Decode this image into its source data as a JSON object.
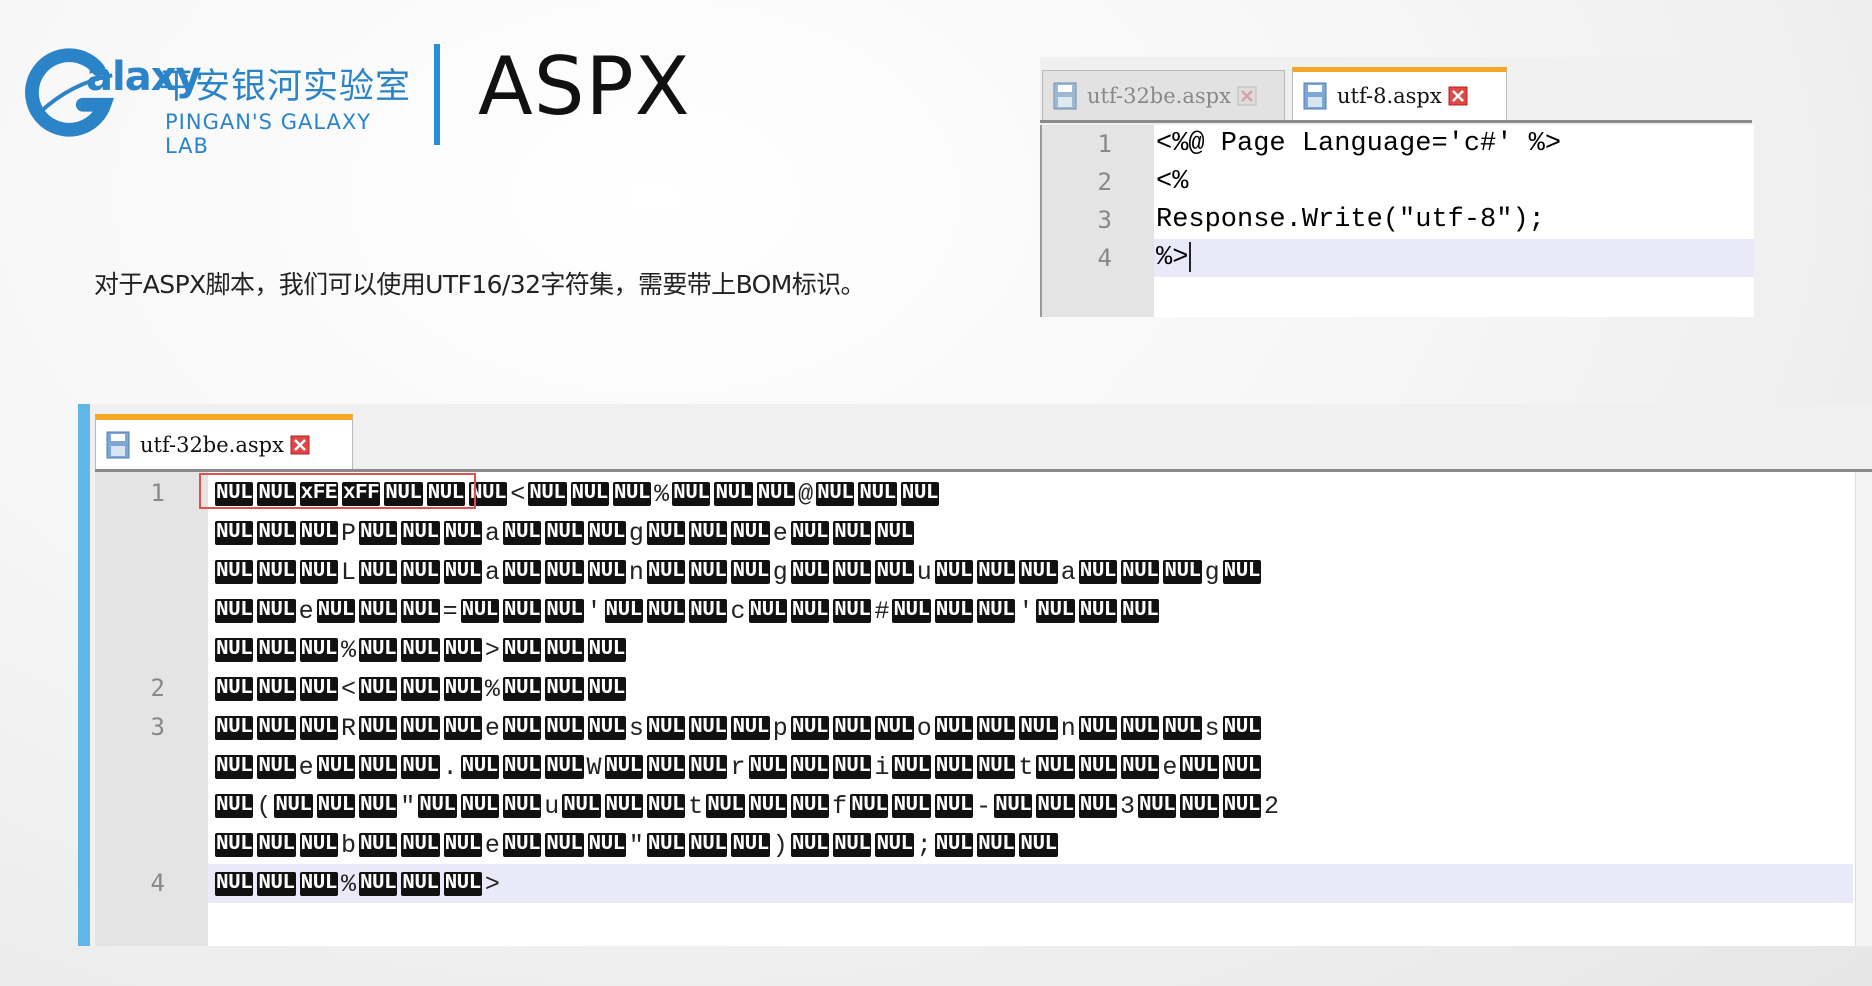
{
  "logo": {
    "icon": "galaxy-g-logo",
    "word": "alaxy",
    "chinese": "平安银河实验室",
    "english": "PINGAN'S GALAXY LAB",
    "color": "#2b84c8"
  },
  "title": "ASPX",
  "description": "对于ASPX脚本，我们可以使用UTF16/32字符集，需要带上BOM标识。",
  "editor_small": {
    "tabs": [
      {
        "label": "utf-32be.aspx",
        "active": false
      },
      {
        "label": "utf-8.aspx",
        "active": true
      }
    ],
    "lines": [
      {
        "num": "1",
        "text": "<%@ Page Language='c#' %>"
      },
      {
        "num": "2",
        "text": "<%"
      },
      {
        "num": "3",
        "text": "Response.Write(\"utf-8\");"
      },
      {
        "num": "4",
        "text": "%>"
      }
    ]
  },
  "editor_big": {
    "tab": {
      "label": "utf-32be.aspx"
    },
    "nul": "NUL",
    "fe": "xFE",
    "ff": "xFF",
    "line_numbers": [
      "1",
      "2",
      "3",
      "4"
    ],
    "rows": [
      {
        "num": "1",
        "tokens": [
          "NUL",
          "NUL",
          "xFE",
          "xFF",
          "NUL",
          "NUL",
          "NUL",
          "<",
          "NUL",
          "NUL",
          "NUL",
          "%",
          "NUL",
          "NUL",
          "NUL",
          "@",
          "NUL",
          "NUL",
          "NUL"
        ]
      },
      {
        "num": "",
        "tokens": [
          "NUL",
          "NUL",
          "NUL",
          "P",
          "NUL",
          "NUL",
          "NUL",
          "a",
          "NUL",
          "NUL",
          "NUL",
          "g",
          "NUL",
          "NUL",
          "NUL",
          "e",
          "NUL",
          "NUL",
          "NUL"
        ]
      },
      {
        "num": "",
        "tokens": [
          "NUL",
          "NUL",
          "NUL",
          "L",
          "NUL",
          "NUL",
          "NUL",
          "a",
          "NUL",
          "NUL",
          "NUL",
          "n",
          "NUL",
          "NUL",
          "NUL",
          "g",
          "NUL",
          "NUL",
          "NUL",
          "u",
          "NUL",
          "NUL",
          "NUL",
          "a",
          "NUL",
          "NUL",
          "NUL",
          "g",
          "NUL"
        ]
      },
      {
        "num": "",
        "tokens": [
          "NUL",
          "NUL",
          "e",
          "NUL",
          "NUL",
          "NUL",
          "=",
          "NUL",
          "NUL",
          "NUL",
          "'",
          "NUL",
          "NUL",
          "NUL",
          "c",
          "NUL",
          "NUL",
          "NUL",
          "#",
          "NUL",
          "NUL",
          "NUL",
          "'",
          "NUL",
          "NUL",
          "NUL"
        ]
      },
      {
        "num": "",
        "tokens": [
          "NUL",
          "NUL",
          "NUL",
          "%",
          "NUL",
          "NUL",
          "NUL",
          ">",
          "NUL",
          "NUL",
          "NUL"
        ]
      },
      {
        "num": "2",
        "tokens": [
          "NUL",
          "NUL",
          "NUL",
          "<",
          "NUL",
          "NUL",
          "NUL",
          "%",
          "NUL",
          "NUL",
          "NUL"
        ]
      },
      {
        "num": "3",
        "tokens": [
          "NUL",
          "NUL",
          "NUL",
          "R",
          "NUL",
          "NUL",
          "NUL",
          "e",
          "NUL",
          "NUL",
          "NUL",
          "s",
          "NUL",
          "NUL",
          "NUL",
          "p",
          "NUL",
          "NUL",
          "NUL",
          "o",
          "NUL",
          "NUL",
          "NUL",
          "n",
          "NUL",
          "NUL",
          "NUL",
          "s",
          "NUL"
        ]
      },
      {
        "num": "",
        "tokens": [
          "NUL",
          "NUL",
          "e",
          "NUL",
          "NUL",
          "NUL",
          ".",
          "NUL",
          "NUL",
          "NUL",
          "W",
          "NUL",
          "NUL",
          "NUL",
          "r",
          "NUL",
          "NUL",
          "NUL",
          "i",
          "NUL",
          "NUL",
          "NUL",
          "t",
          "NUL",
          "NUL",
          "NUL",
          "e",
          "NUL",
          "NUL"
        ]
      },
      {
        "num": "",
        "tokens": [
          "NUL",
          "(",
          "NUL",
          "NUL",
          "NUL",
          "\"",
          "NUL",
          "NUL",
          "NUL",
          "u",
          "NUL",
          "NUL",
          "NUL",
          "t",
          "NUL",
          "NUL",
          "NUL",
          "f",
          "NUL",
          "NUL",
          "NUL",
          "-",
          "NUL",
          "NUL",
          "NUL",
          "3",
          "NUL",
          "NUL",
          "NUL",
          "2"
        ]
      },
      {
        "num": "",
        "tokens": [
          "NUL",
          "NUL",
          "NUL",
          "b",
          "NUL",
          "NUL",
          "NUL",
          "e",
          "NUL",
          "NUL",
          "NUL",
          "\"",
          "NUL",
          "NUL",
          "NUL",
          ")",
          "NUL",
          "NUL",
          "NUL",
          ";",
          "NUL",
          "NUL",
          "NUL"
        ]
      },
      {
        "num": "4",
        "tokens": [
          "NUL",
          "NUL",
          "NUL",
          "%",
          "NUL",
          "NUL",
          "NUL",
          ">"
        ]
      }
    ]
  },
  "colors": {
    "accent": "#2b8fd6",
    "tab_active": "#f5a623",
    "highlight": "#e60000"
  }
}
